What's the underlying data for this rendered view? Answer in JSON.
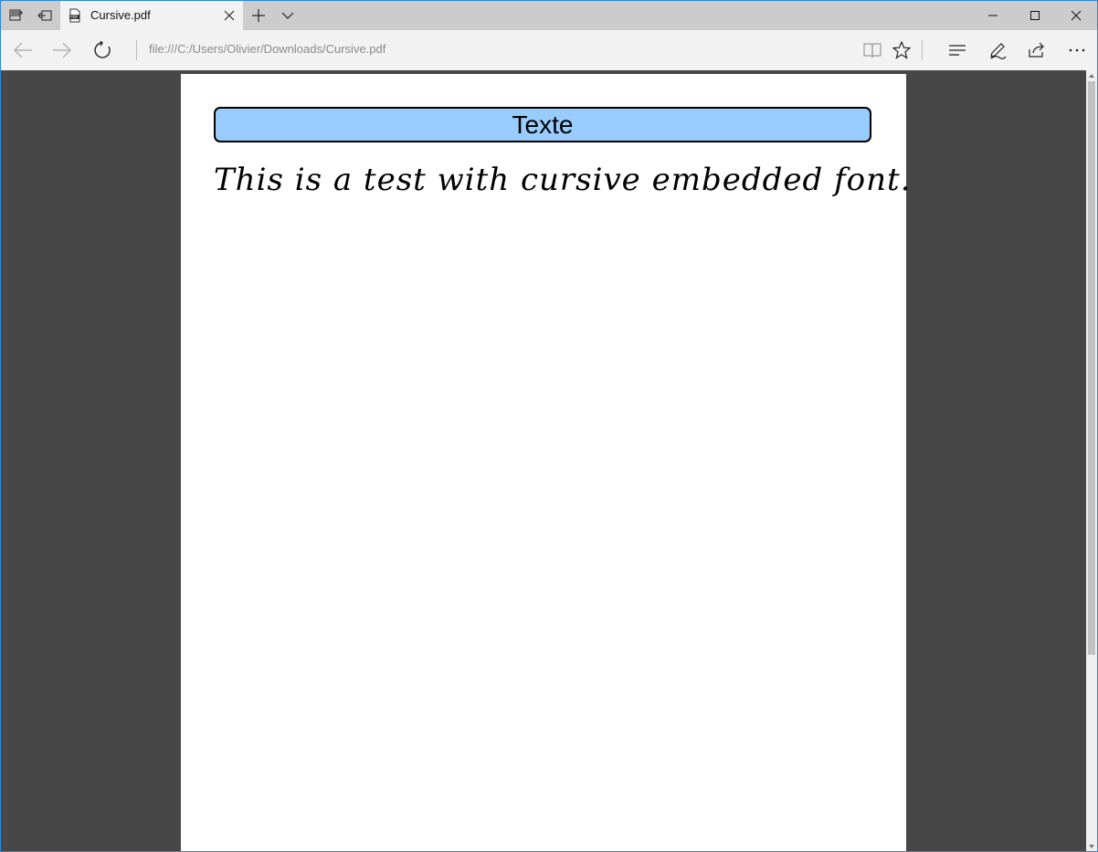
{
  "tabs": [
    {
      "title": "Cursive.pdf",
      "icon": "pdf-icon"
    }
  ],
  "addressBar": {
    "url": "file:///C:/Users/Olivier/Downloads/Cursive.pdf"
  },
  "document": {
    "heading": "Texte",
    "body": "This is a test with cursive embedded font."
  },
  "colors": {
    "tabstrip": "#cccccc",
    "toolbar": "#f2f2f2",
    "viewerBackground": "#474747",
    "headingFill": "#99ccff",
    "windowBorder": "#2b88d8"
  }
}
